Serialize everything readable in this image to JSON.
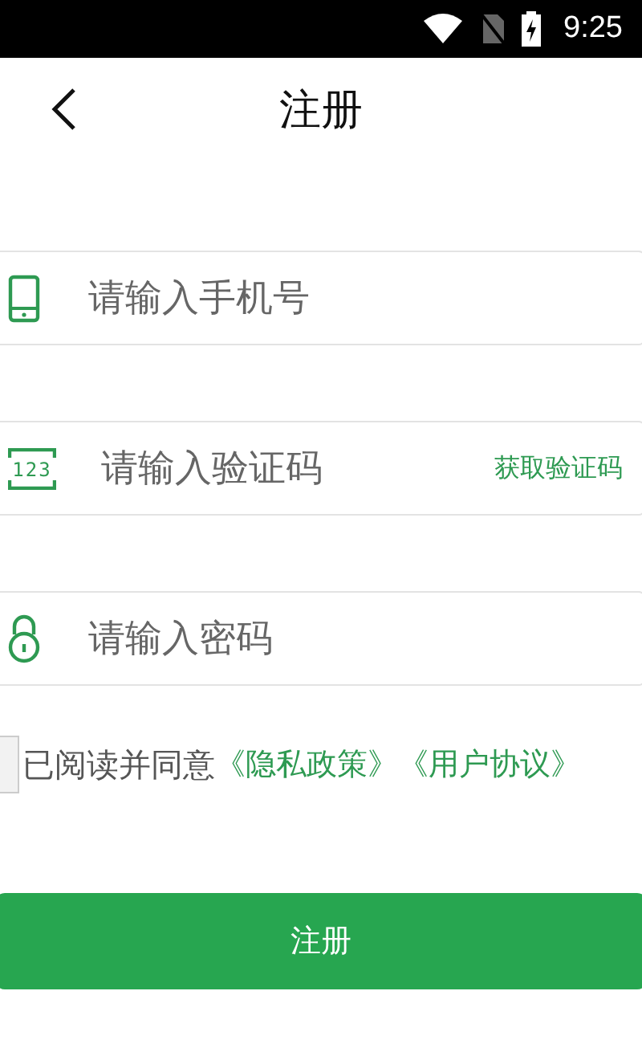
{
  "status_bar": {
    "time": "9:25"
  },
  "header": {
    "title": "注册"
  },
  "fields": [
    {
      "kind": "phone",
      "placeholder": "请输入手机号"
    },
    {
      "kind": "code",
      "placeholder": "请输入验证码",
      "icon_label": "123",
      "action": "获取验证码"
    },
    {
      "kind": "password",
      "placeholder": "请输入密码"
    }
  ],
  "agreement": {
    "checked": false,
    "text": "已阅读并同意",
    "links": [
      "《隐私政策》",
      "《用户协议》"
    ]
  },
  "submit": {
    "label": "注册"
  }
}
